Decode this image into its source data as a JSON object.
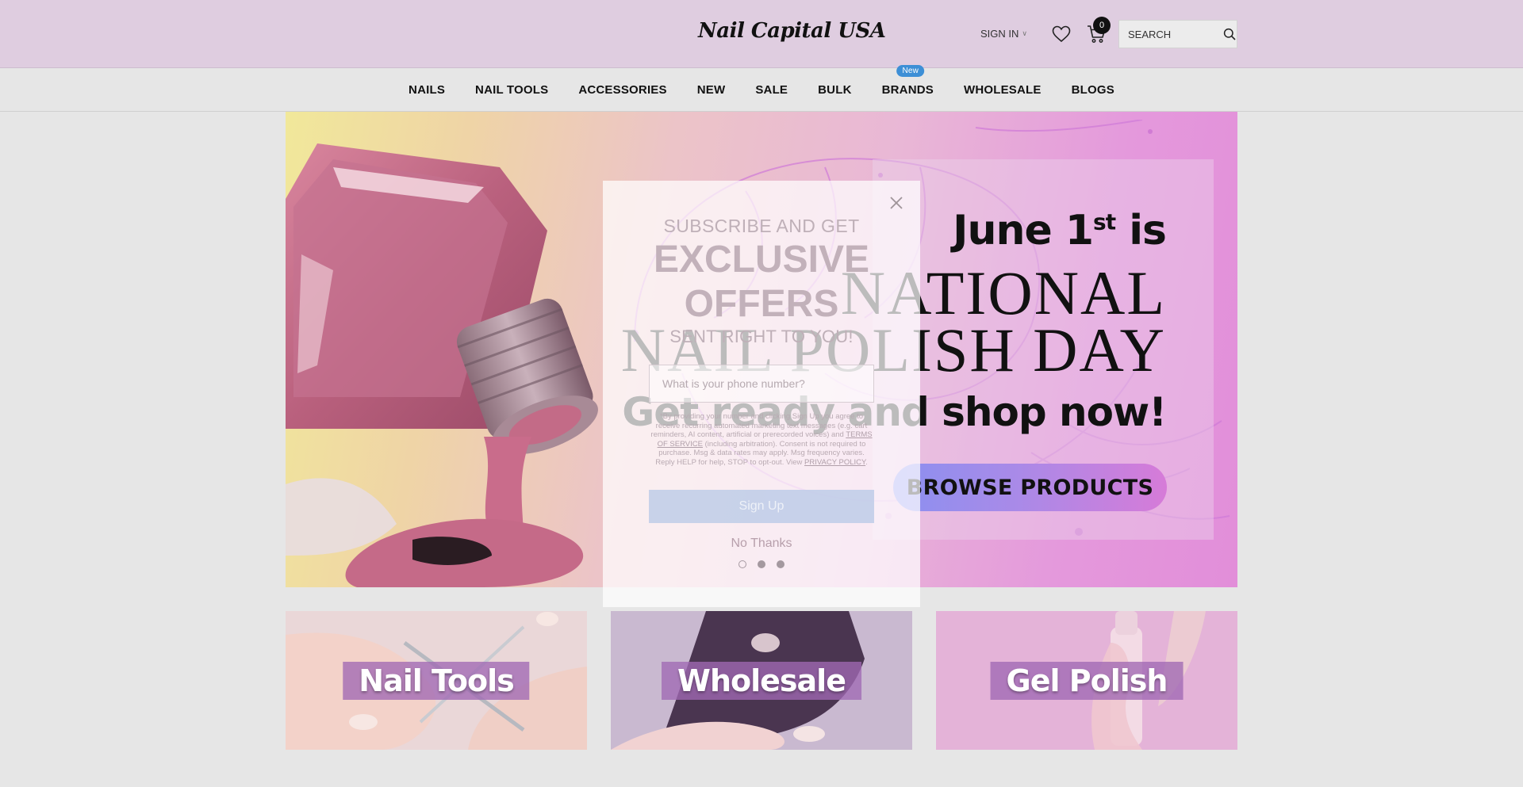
{
  "header": {
    "logo_text": "Nail Capital USA",
    "sign_in_label": "SIGN IN",
    "cart_count": "0",
    "search_placeholder": "SEARCH"
  },
  "nav": {
    "items": [
      "NAILS",
      "NAIL TOOLS",
      "ACCESSORIES",
      "NEW",
      "SALE",
      "BULK",
      "BRANDS",
      "WHOLESALE",
      "BLOGS"
    ],
    "new_badge": "New"
  },
  "hero": {
    "line1_prefix": "June 1",
    "line1_sup": "st",
    "line1_suffix": " is",
    "line2": "NATIONAL",
    "line3": "NAIL POLISH DAY",
    "line4": "Get ready and shop now!",
    "cta": "BROWSE PRODUCTS"
  },
  "popup": {
    "subscribe": "SUBSCRIBE AND GET",
    "headline_1": "EXCLUSIVE",
    "headline_2": "OFFERS",
    "sent": "SENT RIGHT TO YOU!",
    "phone_placeholder": "What is your phone number?",
    "legal_1": "*By providing your number and clicking Sign Up you agree to receive recurring automated marketing text messages (e.g. cart reminders, AI content, artificial or prerecorded voices) and",
    "terms": "TERMS OF SERVICE",
    "legal_2": "(including arbitration). Consent is not required to purchase. Msg & data rates may apply. Msg frequency varies. Reply HELP for help, STOP to opt-out. View",
    "privacy": "PRIVACY POLICY",
    "signup": "Sign Up",
    "no_thanks": "No Thanks"
  },
  "tiles": [
    {
      "label": "Nail Tools"
    },
    {
      "label": "Wholesale"
    },
    {
      "label": "Gel Polish"
    }
  ],
  "colors": {
    "header_bg": "#dfcde0",
    "nav_badge": "#3d8fd6",
    "tile_label_bg": "#a069b4"
  }
}
